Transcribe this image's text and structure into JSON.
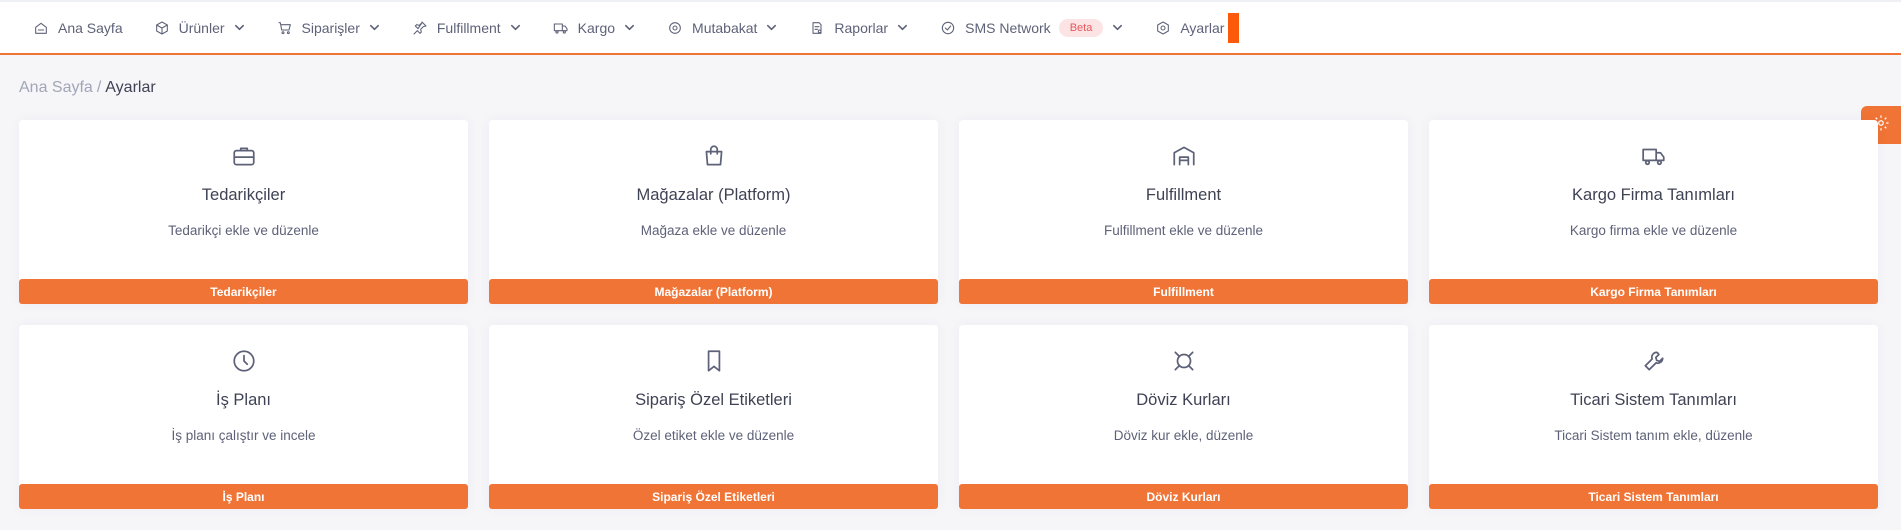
{
  "nav": {
    "items": [
      {
        "label": "Ana Sayfa",
        "icon": "home-icon",
        "dropdown": false
      },
      {
        "label": "Ürünler",
        "icon": "box-icon",
        "dropdown": true
      },
      {
        "label": "Siparişler",
        "icon": "cart-icon",
        "dropdown": true
      },
      {
        "label": "Fulfillment",
        "icon": "pin-icon",
        "dropdown": true
      },
      {
        "label": "Kargo",
        "icon": "truck-icon",
        "dropdown": true
      },
      {
        "label": "Mutabakat",
        "icon": "target-icon",
        "dropdown": true
      },
      {
        "label": "Raporlar",
        "icon": "report-icon",
        "dropdown": true
      },
      {
        "label": "SMS Network",
        "icon": "check-circle-icon",
        "dropdown": true,
        "badge": "Beta"
      },
      {
        "label": "Ayarlar",
        "icon": "hexagon-settings-icon",
        "dropdown": false
      }
    ]
  },
  "breadcrumb": {
    "home": "Ana Sayfa",
    "separator": "/",
    "current": "Ayarlar"
  },
  "cards": [
    {
      "title": "Tedarikçiler",
      "desc": "Tedarikçi ekle ve düzenle",
      "button": "Tedarikçiler",
      "icon": "briefcase-icon"
    },
    {
      "title": "Mağazalar (Platform)",
      "desc": "Mağaza ekle ve düzenle",
      "button": "Mağazalar (Platform)",
      "icon": "shopping-bag-icon"
    },
    {
      "title": "Fulfillment",
      "desc": "Fulfillment ekle ve düzenle",
      "button": "Fulfillment",
      "icon": "warehouse-icon"
    },
    {
      "title": "Kargo Firma Tanımları",
      "desc": "Kargo firma ekle ve düzenle",
      "button": "Kargo Firma Tanımları",
      "icon": "truck-icon"
    },
    {
      "title": "İş Planı",
      "desc": "İş planı çalıştır ve incele",
      "button": "İş Planı",
      "icon": "clock-icon"
    },
    {
      "title": "Sipariş Özel Etiketleri",
      "desc": "Özel etiket ekle ve düzenle",
      "button": "Sipariş Özel Etiketleri",
      "icon": "bookmark-icon"
    },
    {
      "title": "Döviz Kurları",
      "desc": "Döviz kur ekle, düzenle",
      "button": "Döviz Kurları",
      "icon": "currency-icon"
    },
    {
      "title": "Ticari Sistem Tanımları",
      "desc": "Ticari Sistem tanım ekle, düzenle",
      "button": "Ticari Sistem Tanımları",
      "icon": "wrench-icon"
    }
  ],
  "colors": {
    "accent": "#f07435",
    "active_tab": "#fa5a0a",
    "badge_bg": "#fde4e4",
    "badge_text": "#e5585e"
  },
  "floating_button": {
    "icon": "gear-icon"
  }
}
